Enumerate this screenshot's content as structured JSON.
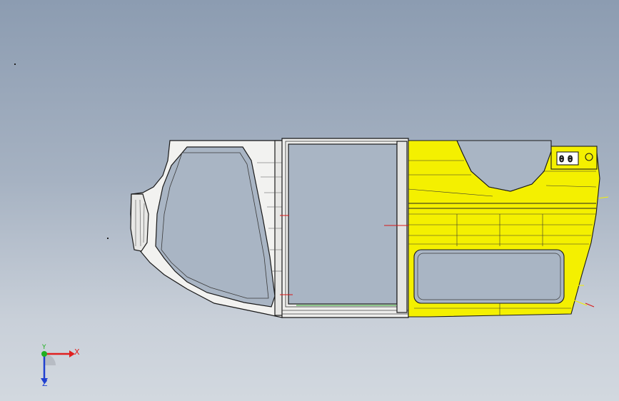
{
  "viewport": {
    "background_top": "#8c9cb1",
    "background_bottom": "#d2d8df"
  },
  "model": {
    "name_icon": "car-body-side-panel-wireframe",
    "colors": {
      "outline": "#1a1a1a",
      "yellow_part": "#f4f000",
      "white_part": "#f2f2f0",
      "sketch_red": "#d81818",
      "sketch_green": "#2da02d"
    }
  },
  "triad": {
    "icon": "coordinate-triad-icon",
    "x_label": "X",
    "y_label": "Y",
    "z_label": "Z",
    "x_color": "#e02020",
    "y_color": "#20b020",
    "z_color": "#2040d0"
  }
}
